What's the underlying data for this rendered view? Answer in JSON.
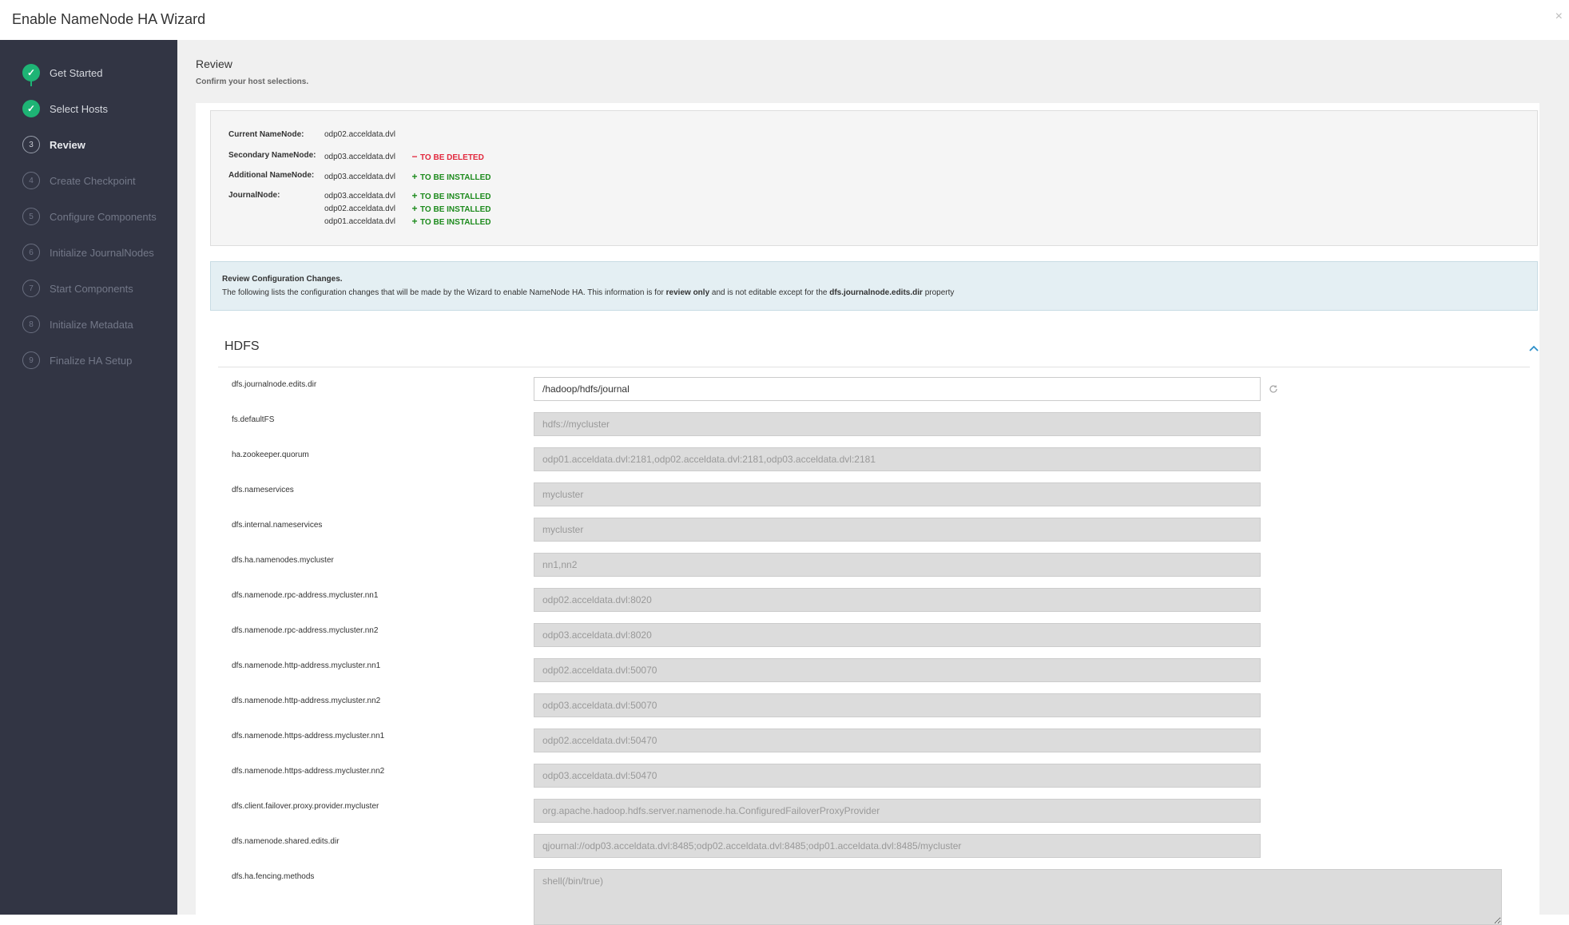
{
  "header": {
    "title": "Enable NameNode HA Wizard",
    "close_symbol": "×"
  },
  "sidebar": {
    "steps": [
      {
        "num": "1",
        "label": "Get Started",
        "state": "done",
        "icon": "check-icon"
      },
      {
        "num": "2",
        "label": "Select Hosts",
        "state": "done",
        "icon": "check-icon"
      },
      {
        "num": "3",
        "label": "Review",
        "state": "current"
      },
      {
        "num": "4",
        "label": "Create Checkpoint",
        "state": "todo"
      },
      {
        "num": "5",
        "label": "Configure Components",
        "state": "todo"
      },
      {
        "num": "6",
        "label": "Initialize JournalNodes",
        "state": "todo"
      },
      {
        "num": "7",
        "label": "Start Components",
        "state": "todo"
      },
      {
        "num": "8",
        "label": "Initialize Metadata",
        "state": "todo"
      },
      {
        "num": "9",
        "label": "Finalize HA Setup",
        "state": "todo"
      }
    ]
  },
  "main": {
    "title": "Review",
    "subtitle": "Confirm your host selections."
  },
  "hosts": {
    "current_namenode": {
      "label": "Current NameNode:",
      "host": "odp02.acceldata.dvl"
    },
    "secondary_namenode": {
      "label": "Secondary NameNode:",
      "host": "odp03.acceldata.dvl",
      "status": "TO BE DELETED",
      "status_symbol": "−"
    },
    "additional_namenode": {
      "label": "Additional NameNode:",
      "host": "odp03.acceldata.dvl",
      "status": "TO BE INSTALLED",
      "status_symbol": "+"
    },
    "journalnode": {
      "label": "JournalNode:",
      "items": [
        {
          "host": "odp03.acceldata.dvl",
          "status": "TO BE INSTALLED",
          "status_symbol": "+"
        },
        {
          "host": "odp02.acceldata.dvl",
          "status": "TO BE INSTALLED",
          "status_symbol": "+"
        },
        {
          "host": "odp01.acceldata.dvl",
          "status": "TO BE INSTALLED",
          "status_symbol": "+"
        }
      ]
    }
  },
  "info": {
    "title": "Review Configuration Changes.",
    "text_before": "The following lists the configuration changes that will be made by the Wizard to enable NameNode HA. This information is for ",
    "bold1": "review only",
    "text_middle": " and is not editable except for the ",
    "bold2": "dfs.journalnode.edits.dir",
    "text_after": " property"
  },
  "hdfs": {
    "title": "HDFS",
    "properties": [
      {
        "name": "dfs.journalnode.edits.dir",
        "value": "/hadoop/hdfs/journal",
        "editable": true
      },
      {
        "name": "fs.defaultFS",
        "value": "hdfs://mycluster"
      },
      {
        "name": "ha.zookeeper.quorum",
        "value": "odp01.acceldata.dvl:2181,odp02.acceldata.dvl:2181,odp03.acceldata.dvl:2181"
      },
      {
        "name": "dfs.nameservices",
        "value": "mycluster"
      },
      {
        "name": "dfs.internal.nameservices",
        "value": "mycluster"
      },
      {
        "name": "dfs.ha.namenodes.mycluster",
        "value": "nn1,nn2"
      },
      {
        "name": "dfs.namenode.rpc-address.mycluster.nn1",
        "value": "odp02.acceldata.dvl:8020"
      },
      {
        "name": "dfs.namenode.rpc-address.mycluster.nn2",
        "value": "odp03.acceldata.dvl:8020"
      },
      {
        "name": "dfs.namenode.http-address.mycluster.nn1",
        "value": "odp02.acceldata.dvl:50070"
      },
      {
        "name": "dfs.namenode.http-address.mycluster.nn2",
        "value": "odp03.acceldata.dvl:50070"
      },
      {
        "name": "dfs.namenode.https-address.mycluster.nn1",
        "value": "odp02.acceldata.dvl:50470"
      },
      {
        "name": "dfs.namenode.https-address.mycluster.nn2",
        "value": "odp03.acceldata.dvl:50470"
      },
      {
        "name": "dfs.client.failover.proxy.provider.mycluster",
        "value": "org.apache.hadoop.hdfs.server.namenode.ha.ConfiguredFailoverProxyProvider"
      },
      {
        "name": "dfs.namenode.shared.edits.dir",
        "value": "qjournal://odp03.acceldata.dvl:8485;odp02.acceldata.dvl:8485;odp01.acceldata.dvl:8485/mycluster"
      },
      {
        "name": "dfs.ha.fencing.methods",
        "value": "shell(/bin/true)",
        "multiline": true
      }
    ]
  },
  "colors": {
    "sidebar_bg": "#323544",
    "step_done": "#1eb475",
    "deleted": "#e2283d",
    "installed": "#1d8b1d",
    "info_bg": "#e4eff3",
    "accent": "#2b8fc9"
  }
}
